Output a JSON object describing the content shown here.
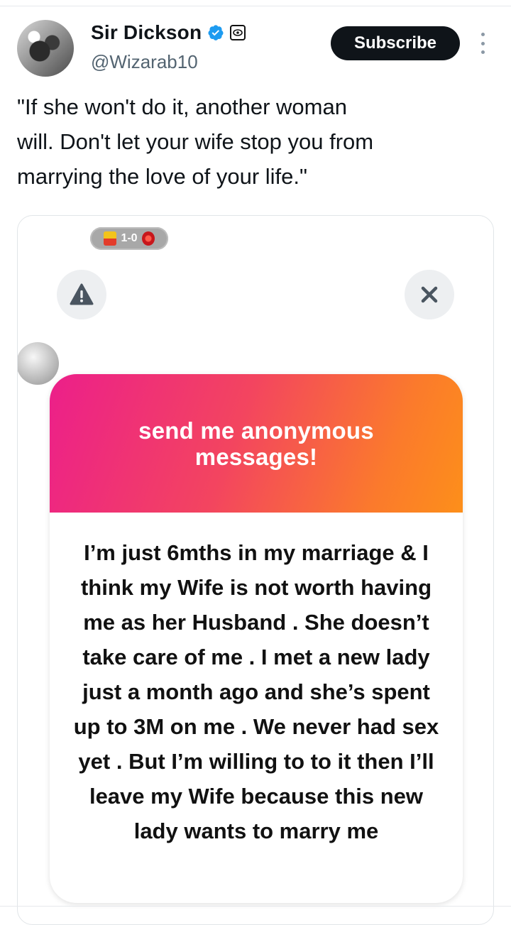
{
  "author": {
    "name": "Sir Dickson",
    "handle": "@Wizarab10"
  },
  "header": {
    "subscribe_label": "Subscribe"
  },
  "tweet": {
    "text": "\"If she won't do it, another woman\nwill. Don't let your wife stop you from\nmarrying the love of your life.\""
  },
  "media": {
    "score_text": "1-0",
    "icons": [
      "warning-icon",
      "close-icon"
    ],
    "ngl": {
      "header": "send me anonymous messages!",
      "message": "I’m just 6mths in my marriage & I think my Wife is not worth having me as her Husband . She doesn’t take care of me . I met a new lady just a month ago and she’s spent up to 3M on me . We never had sex yet . But I’m willing to to it then I’ll leave my Wife because this new lady wants to marry me",
      "gradient_colors": [
        "#ec1f8a",
        "#fd8f1a"
      ]
    }
  },
  "colors": {
    "verified_blue": "#1d9bf0",
    "subscribe_bg": "#0f1419",
    "handle_grey": "#536471"
  }
}
